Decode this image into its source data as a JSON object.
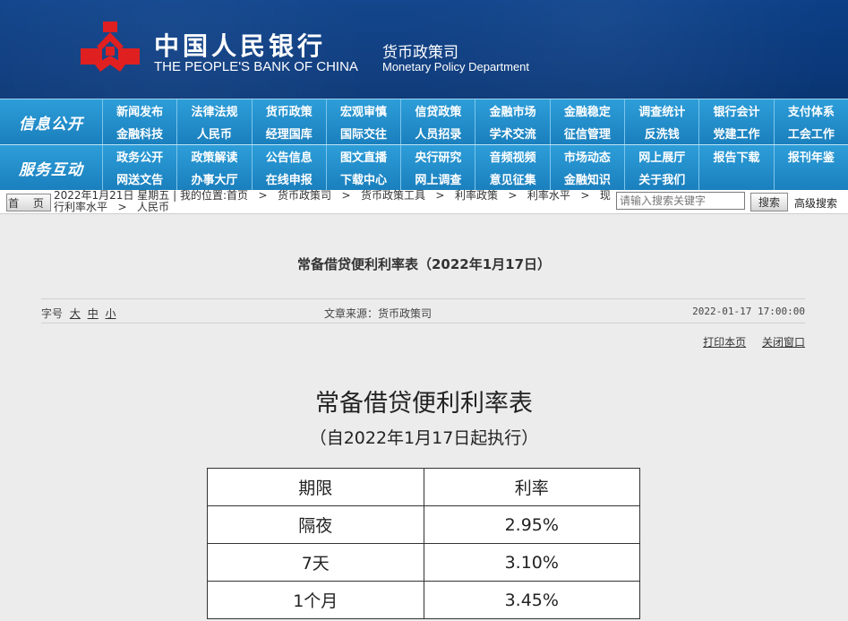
{
  "header": {
    "bank_cn": "中国人民银行",
    "bank_en": "THE PEOPLE'S BANK OF CHINA",
    "dept_cn": "货币政策司",
    "dept_en": "Monetary Policy Department"
  },
  "nav": [
    {
      "section": "信息公开",
      "items": [
        "新闻发布",
        "法律法规",
        "货币政策",
        "宏观审慎",
        "信贷政策",
        "金融市场",
        "金融稳定",
        "调查统计",
        "银行会计",
        "支付体系",
        "金融科技",
        "人民币",
        "经理国库",
        "国际交往",
        "人员招录",
        "学术交流",
        "征信管理",
        "反洗钱",
        "党建工作",
        "工会工作"
      ]
    },
    {
      "section": "服务互动",
      "items": [
        "政务公开",
        "政策解读",
        "公告信息",
        "图文直播",
        "央行研究",
        "音频视频",
        "市场动态",
        "网上展厅",
        "报告下载",
        "报刊年鉴",
        "网送文告",
        "办事大厅",
        "在线申报",
        "下载中心",
        "网上调查",
        "意见征集",
        "金融知识",
        "关于我们",
        "",
        ""
      ]
    }
  ],
  "breadcrumb": {
    "home_label": "首 页",
    "date": "2022年1月21日 星期五",
    "location_label": "我的位置:首页",
    "path": [
      "货币政策司",
      "货币政策工具",
      "利率政策",
      "利率水平",
      "现行利率水平",
      "人民币"
    ]
  },
  "search": {
    "placeholder": "请输入搜索关键字",
    "button_label": "搜索",
    "advanced_label": "高级搜索"
  },
  "article": {
    "title": "常备借贷便利利率表（2022年1月17日）",
    "font_size_label": "字号",
    "font_sizes": [
      "大",
      "中",
      "小"
    ],
    "source": "文章来源：货币政策司",
    "date": "2022-01-17 17:00:00",
    "print_label": "打印本页",
    "close_label": "关闭窗口",
    "heading": "常备借贷便利利率表",
    "subheading": "（自2022年1月17日起执行）",
    "table": {
      "headers": [
        "期限",
        "利率"
      ],
      "rows": [
        [
          "隔夜",
          "2.95%"
        ],
        [
          "7天",
          "3.10%"
        ],
        [
          "1个月",
          "3.45%"
        ]
      ]
    }
  },
  "colors": {
    "header_bg": "#0c3f86",
    "nav_bg": "#2d9ed9",
    "logo_red": "#e02020",
    "page_bg": "#ececec"
  }
}
